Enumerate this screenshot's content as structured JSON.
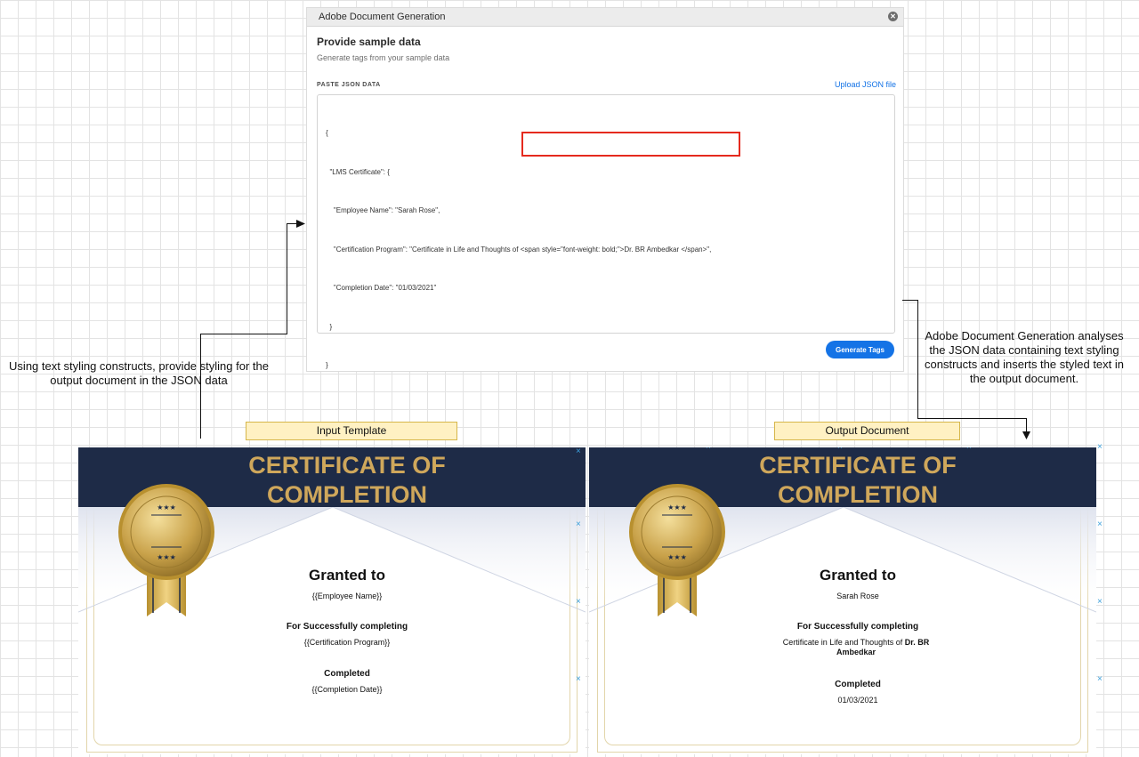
{
  "dialog": {
    "title": "Adobe Document Generation",
    "heading": "Provide sample data",
    "subheading": "Generate tags from your sample data",
    "paste_label": "PASTE JSON DATA",
    "upload_link": "Upload JSON file",
    "json_lines": [
      "{",
      "  \"LMS Certificate\": {",
      "    \"Employee Name\": \"Sarah Rose\",",
      "    \"Certification Program\": \"Certificate in Life and Thoughts of <span style=\"font-weight: bold;\">Dr. BR Ambedkar </span>\",",
      "    \"Completion Date\": \"01/03/2021\"",
      "  }",
      "}"
    ],
    "generate_button": "Generate Tags"
  },
  "annotations": {
    "left": "Using text styling constructs, provide styling for the output document in the JSON data",
    "right": "Adobe Document Generation analyses the JSON data containing text styling constructs and inserts the styled text in the output document.",
    "input_label": "Input Template",
    "output_label": "Output Document"
  },
  "input_cert": {
    "header_line1": "CERTIFICATE OF",
    "header_line2": "COMPLETION",
    "granted": "Granted to",
    "name": "{{Employee Name}}",
    "for_text": "For Successfully completing",
    "program": "{{Certification Program}}",
    "completed": "Completed",
    "date": "{{Completion Date}}"
  },
  "output_cert": {
    "header_line1": "CERTIFICATE OF",
    "header_line2": "COMPLETION",
    "granted": "Granted to",
    "name": "Sarah Rose",
    "for_text": "For Successfully completing",
    "program_plain": "Certificate in Life and Thoughts of ",
    "program_bold": "Dr. BR Ambedkar",
    "completed": "Completed",
    "date": "01/03/2021"
  },
  "colors": {
    "header_bg": "#1e2b47",
    "header_text": "#cfa75b",
    "accent_blue": "#1473e6",
    "highlight_red": "#e52a1e",
    "label_yellow": "#fff1c3"
  }
}
